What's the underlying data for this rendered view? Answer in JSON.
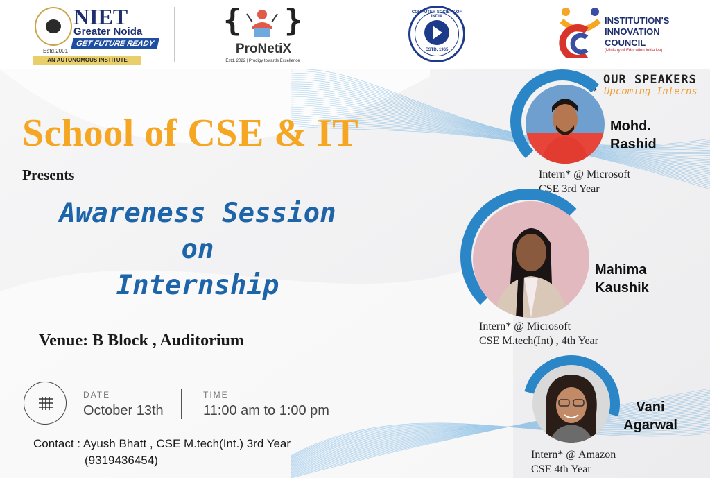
{
  "colors": {
    "school_orange": "#f5a623",
    "session_blue": "#1e64a8",
    "accent_arc": "#2a86c7",
    "upcoming_orange": "#f0a03a",
    "background": "#f3f3f4"
  },
  "header": {
    "niet": {
      "name": "NIET",
      "city": "Greater Noida",
      "tagline": "GET FUTURE READY",
      "estd": "Estd.2001",
      "badge": "AN AUTONOMOUS INSTITUTE"
    },
    "pronetix": {
      "left_brace": "{",
      "right_brace": "}",
      "name": "ProNetiX",
      "subtitle": "Estd. 2022 | Prodigy towards Excellence"
    },
    "csi": {
      "top_text": "COMPUTER SOCIETY OF INDIA",
      "estd": "ESTD. 1965"
    },
    "iic": {
      "line1": "INSTITUTION'S",
      "line2": "INNOVATION",
      "line3": "COUNCIL",
      "sub": "(Ministry of Education Initiative)"
    }
  },
  "main": {
    "school": "School of CSE & IT",
    "presents": "Presents",
    "session_line1": "Awareness Session",
    "session_line2": "on",
    "session_line3": "Internship",
    "venue": "Venue: B Block , Auditorium",
    "date_label": "DATE",
    "date_value": "October 13th",
    "time_label": "TIME",
    "time_value": "11:00 am to 1:00 pm",
    "calendar_icon": "calendar-grid-icon",
    "contact": "Contact : Ayush Bhatt , CSE M.tech(Int.) 3rd Year",
    "phone": "(9319436454)"
  },
  "speakers": {
    "heading": "OUR SPEAKERS",
    "star": "*",
    "subheading": "Upcoming Interns",
    "list": [
      {
        "name_line1": "Mohd.",
        "name_line2": "Rashid",
        "role": "Intern* @ Microsoft",
        "year": "CSE 3rd Year"
      },
      {
        "name_line1": "Mahima",
        "name_line2": "Kaushik",
        "role": "Intern* @ Microsoft",
        "year": "CSE M.tech(Int) , 4th Year"
      },
      {
        "name_line1": "Vani",
        "name_line2": "Agarwal",
        "role": "Intern* @ Amazon",
        "year": "CSE 4th Year"
      }
    ]
  }
}
